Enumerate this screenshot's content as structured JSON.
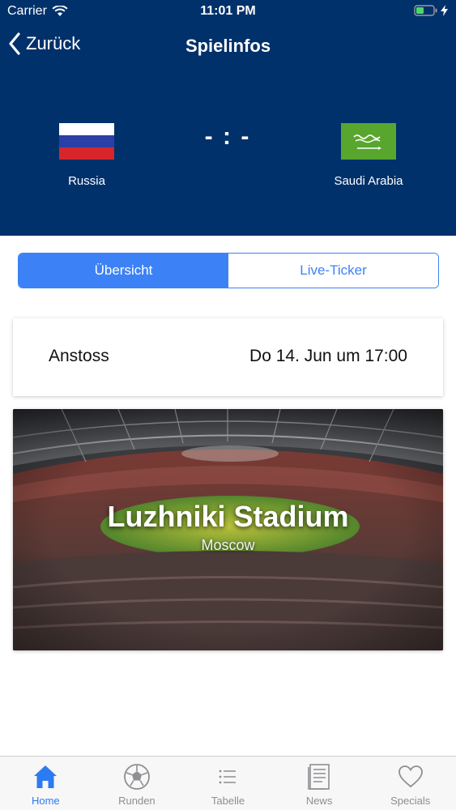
{
  "status_bar": {
    "carrier": "Carrier",
    "time": "11:01 PM"
  },
  "nav": {
    "back_label": "Zurück",
    "title": "Spielinfos"
  },
  "match": {
    "home_team": "Russia",
    "away_team": "Saudi Arabia",
    "score": "- : -"
  },
  "segments": {
    "active": "Übersicht",
    "inactive": "Live-Ticker"
  },
  "kickoff": {
    "label": "Anstoss",
    "value": "Do 14. Jun um 17:00"
  },
  "stadium": {
    "name": "Luzhniki Stadium",
    "city": "Moscow"
  },
  "tabbar": {
    "items": [
      {
        "label": "Home",
        "icon": "home-icon",
        "active": true
      },
      {
        "label": "Runden",
        "icon": "football-icon",
        "active": false
      },
      {
        "label": "Tabelle",
        "icon": "list-icon",
        "active": false
      },
      {
        "label": "News",
        "icon": "news-icon",
        "active": false
      },
      {
        "label": "Specials",
        "icon": "heart-icon",
        "active": false
      }
    ]
  },
  "colors": {
    "header_bg": "#01316b",
    "accent": "#3c82f6",
    "tab_active": "#2d7bf0",
    "tab_inactive": "#8e8e93"
  }
}
